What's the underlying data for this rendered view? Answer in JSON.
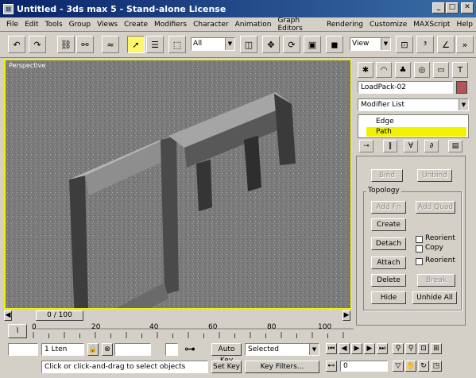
{
  "window": {
    "title": "Untitled - 3ds max 5 - Stand-alone License"
  },
  "menu": [
    "File",
    "Edit",
    "Tools",
    "Group",
    "Views",
    "Create",
    "Modifiers",
    "Character",
    "Animation",
    "Graph Editors",
    "Rendering",
    "Customize",
    "MAXScript",
    "Help"
  ],
  "toolbar": {
    "selection_filter": "All",
    "coord_system": "View"
  },
  "viewport": {
    "label": "Perspective"
  },
  "panel": {
    "object_name": "LoadPack-02",
    "modifier_list": "Modifier List",
    "stack": [
      {
        "label": "Edge",
        "selected": false
      },
      {
        "label": "Path",
        "selected": true
      }
    ],
    "bind_label": "Bind",
    "unbind_label": "Unbind",
    "topology_title": "Topology",
    "add_fn_label": "Add Fn",
    "add_quad_label": "Add Quad",
    "create_label": "Create",
    "detach_label": "Detach",
    "reorient_label": "Reorient",
    "copy_label": "Copy",
    "attach_label": "Attach",
    "reorient2_label": "Reorient",
    "delete_label": "Delete",
    "break_label": "Break",
    "hide_label": "Hide",
    "unhide_all_label": "Unhide All"
  },
  "timeline": {
    "frame_label": "0 / 100",
    "ticks": [
      "0",
      "20",
      "40",
      "60",
      "80",
      "100"
    ]
  },
  "status": {
    "selection": "1 Lten",
    "prompt": "Click or click-and-drag to select objects",
    "auto_key": "Auto Key",
    "set_key": "Set Key",
    "key_filters": "Key Filters...",
    "key_mode": "Selected",
    "frame": "0"
  }
}
